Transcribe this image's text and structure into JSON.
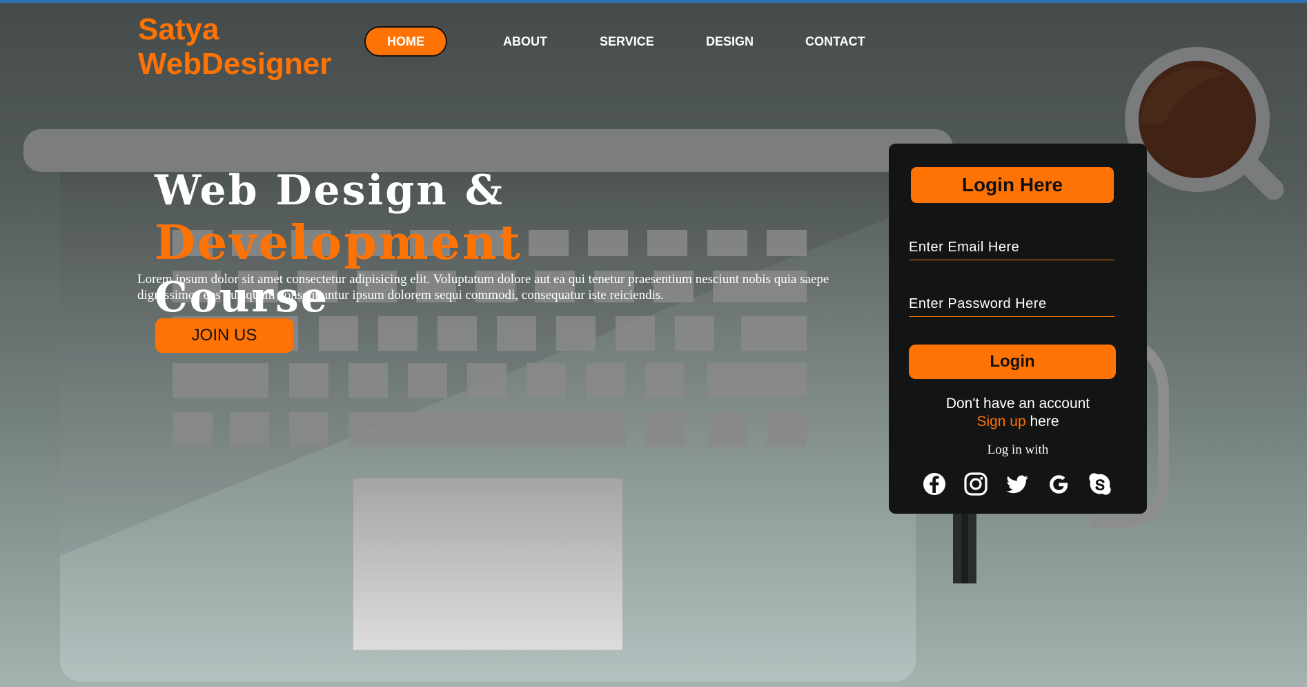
{
  "logo": {
    "line1": "Satya",
    "line2": "WebDesigner"
  },
  "nav": {
    "items": [
      {
        "label": "HOME",
        "active": true
      },
      {
        "label": "ABOUT",
        "active": false
      },
      {
        "label": "SERVICE",
        "active": false
      },
      {
        "label": "DESIGN",
        "active": false
      },
      {
        "label": "CONTACT",
        "active": false
      }
    ]
  },
  "hero": {
    "title_part1": "Web Design & ",
    "title_accent": "Development",
    "title_part2": "Course",
    "text": "Lorem ipsum dolor sit amet consectetur adipisicing elit. Voluptatum dolore aut ea qui tenetur praesentium nesciunt nobis quia saepe dignissimos eos quisquam consequuntur ipsum dolorem sequi commodi, consequatur iste reiciendis.",
    "join_label": "JOIN US"
  },
  "login": {
    "heading": "Login Here",
    "email_placeholder": "Enter Email Here",
    "password_placeholder": "Enter Password Here",
    "login_label": "Login",
    "no_account_text": "Don't have an account",
    "signup_link": "Sign up",
    "signup_suffix": " here",
    "login_with": "Log in with",
    "socials": [
      "facebook-icon",
      "instagram-icon",
      "twitter-icon",
      "google-icon",
      "skype-icon"
    ]
  },
  "colors": {
    "accent": "#ff7304",
    "card": "#131414",
    "top_line": "#2f6fb3"
  }
}
